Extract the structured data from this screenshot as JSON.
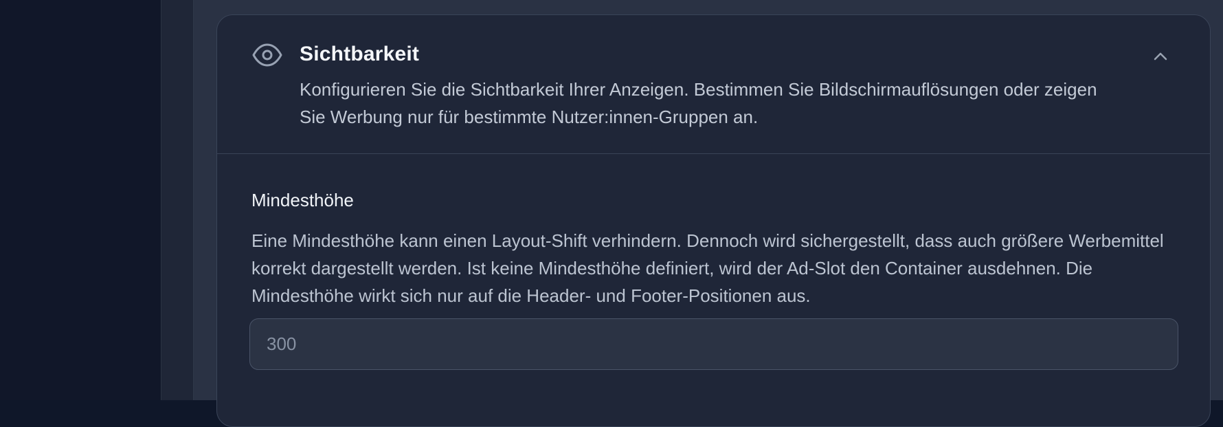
{
  "visibility_section": {
    "title": "Sichtbarkeit",
    "description": "Konfigurieren Sie die Sichtbarkeit Ihrer Anzeigen. Bestimmen Sie Bildschirmauflösungen oder zeigen Sie Werbung nur für bestimmte Nutzer:innen-Gruppen an.",
    "icon": "eye-icon",
    "collapse_icon": "chevron-up-icon"
  },
  "min_height_field": {
    "label": "Mindesthöhe",
    "help": "Eine Mindesthöhe kann einen Layout-Shift verhindern. Dennoch wird sichergestellt, dass auch größere Werbemittel korrekt dargestellt werden. Ist keine Mindesthöhe definiert, wird der Ad-Slot den Container ausdehnen. Die Mindesthöhe wirkt sich nur auf die Header- und Footer-Positionen aus.",
    "value": "",
    "placeholder": "300"
  },
  "colors": {
    "background": "#0f1729",
    "card": "#1f2638",
    "border": "#3a4458",
    "text_primary": "#f5f7fa",
    "text_secondary": "#c3cad6"
  }
}
